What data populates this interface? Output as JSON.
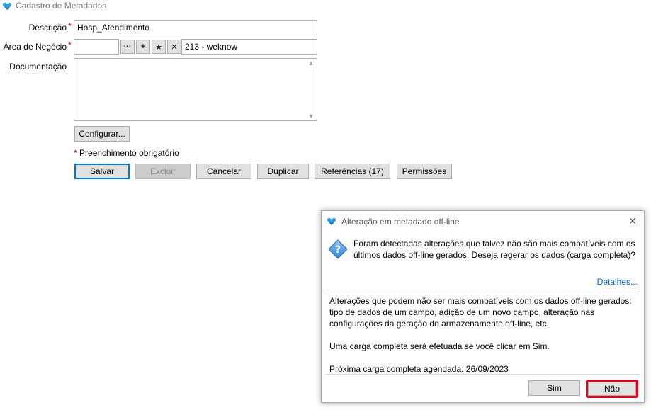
{
  "window": {
    "title": "Cadastro de Metadados"
  },
  "form": {
    "descricao_label": "Descrição",
    "descricao_value": "Hosp_Atendimento",
    "area_label": "Área de Negócio",
    "area_code": "",
    "area_name": "213 - weknow",
    "documentacao_label": "Documentação",
    "required_mark": "*",
    "required_note": "Preenchimento obrigatório",
    "configurar_label": "Configurar...",
    "lookup_buttons": [
      "···",
      "+",
      "★",
      "✕"
    ]
  },
  "actions": {
    "salvar": "Salvar",
    "excluir": "Excluir",
    "cancelar": "Cancelar",
    "duplicar": "Duplicar",
    "referencias": "Referências (17)",
    "permissoes": "Permissões"
  },
  "dialog": {
    "title": "Alteração em metadado off-line",
    "close": "✕",
    "message": "Foram detectadas alterações que talvez não são mais compatíveis com os últimos dados off-line gerados. Deseja regerar os dados (carga completa)?",
    "details_link": "Detalhes...",
    "body_1": "Alterações que podem não ser mais compatíveis com os dados off-line gerados: tipo de dados de um campo, adição de um novo campo, alteração nas configurações da geração do armazenamento off-line, etc.",
    "body_2": "Uma carga completa será efetuada se você clicar em Sim.",
    "body_3": "Próxima carga completa agendada: 26/09/2023",
    "sim": "Sim",
    "nao": "Não"
  },
  "colors": {
    "accent": "#0078d7",
    "required": "#cc0000",
    "highlight": "#e0001b",
    "link": "#0066cc"
  },
  "icons": {
    "app": "weknow-heart-logo",
    "dialog": "question-icon"
  }
}
